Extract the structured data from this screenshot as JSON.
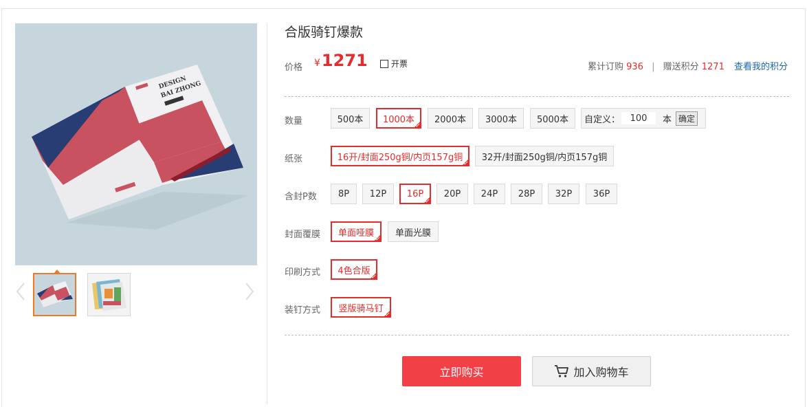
{
  "product": {
    "title": "合版骑钉爆款",
    "price_label": "价格",
    "currency": "¥",
    "price": "1271",
    "invoice_label": "开票"
  },
  "stats": {
    "orders_label": "累计订购",
    "orders_count": "936",
    "separator": "|",
    "points_label": "赠送积分",
    "points_value": "1271",
    "my_points_link": "查看我的积分"
  },
  "options": {
    "quantity": {
      "label": "数量",
      "items": [
        "500本",
        "1000本",
        "2000本",
        "3000本",
        "5000本"
      ],
      "selected": "1000本",
      "custom_label": "自定义：",
      "custom_value": "100",
      "custom_unit": "本",
      "confirm_label": "确定"
    },
    "paper": {
      "label": "纸张",
      "items": [
        "16开/封面250g铜/内页157g铜",
        "32开/封面250g铜/内页157g铜"
      ],
      "selected": "16开/封面250g铜/内页157g铜"
    },
    "pages": {
      "label": "含封P数",
      "items": [
        "8P",
        "12P",
        "16P",
        "20P",
        "24P",
        "28P",
        "32P",
        "36P"
      ],
      "selected": "16P"
    },
    "lamination": {
      "label": "封面覆膜",
      "items": [
        "单面哑膜",
        "单面光膜"
      ],
      "selected": "单面哑膜"
    },
    "printing": {
      "label": "印刷方式",
      "items": [
        "4色合版"
      ],
      "selected": "4色合版"
    },
    "binding": {
      "label": "装钉方式",
      "items": [
        "竖版骑马钉"
      ],
      "selected": "竖版骑马钉"
    }
  },
  "actions": {
    "buy_label": "立即购买",
    "cart_label": "加入购物车"
  },
  "colors": {
    "accent": "#e52b2b",
    "buy_button": "#f24146",
    "thumb_active": "#e87a2b",
    "link": "#1a65b5"
  }
}
